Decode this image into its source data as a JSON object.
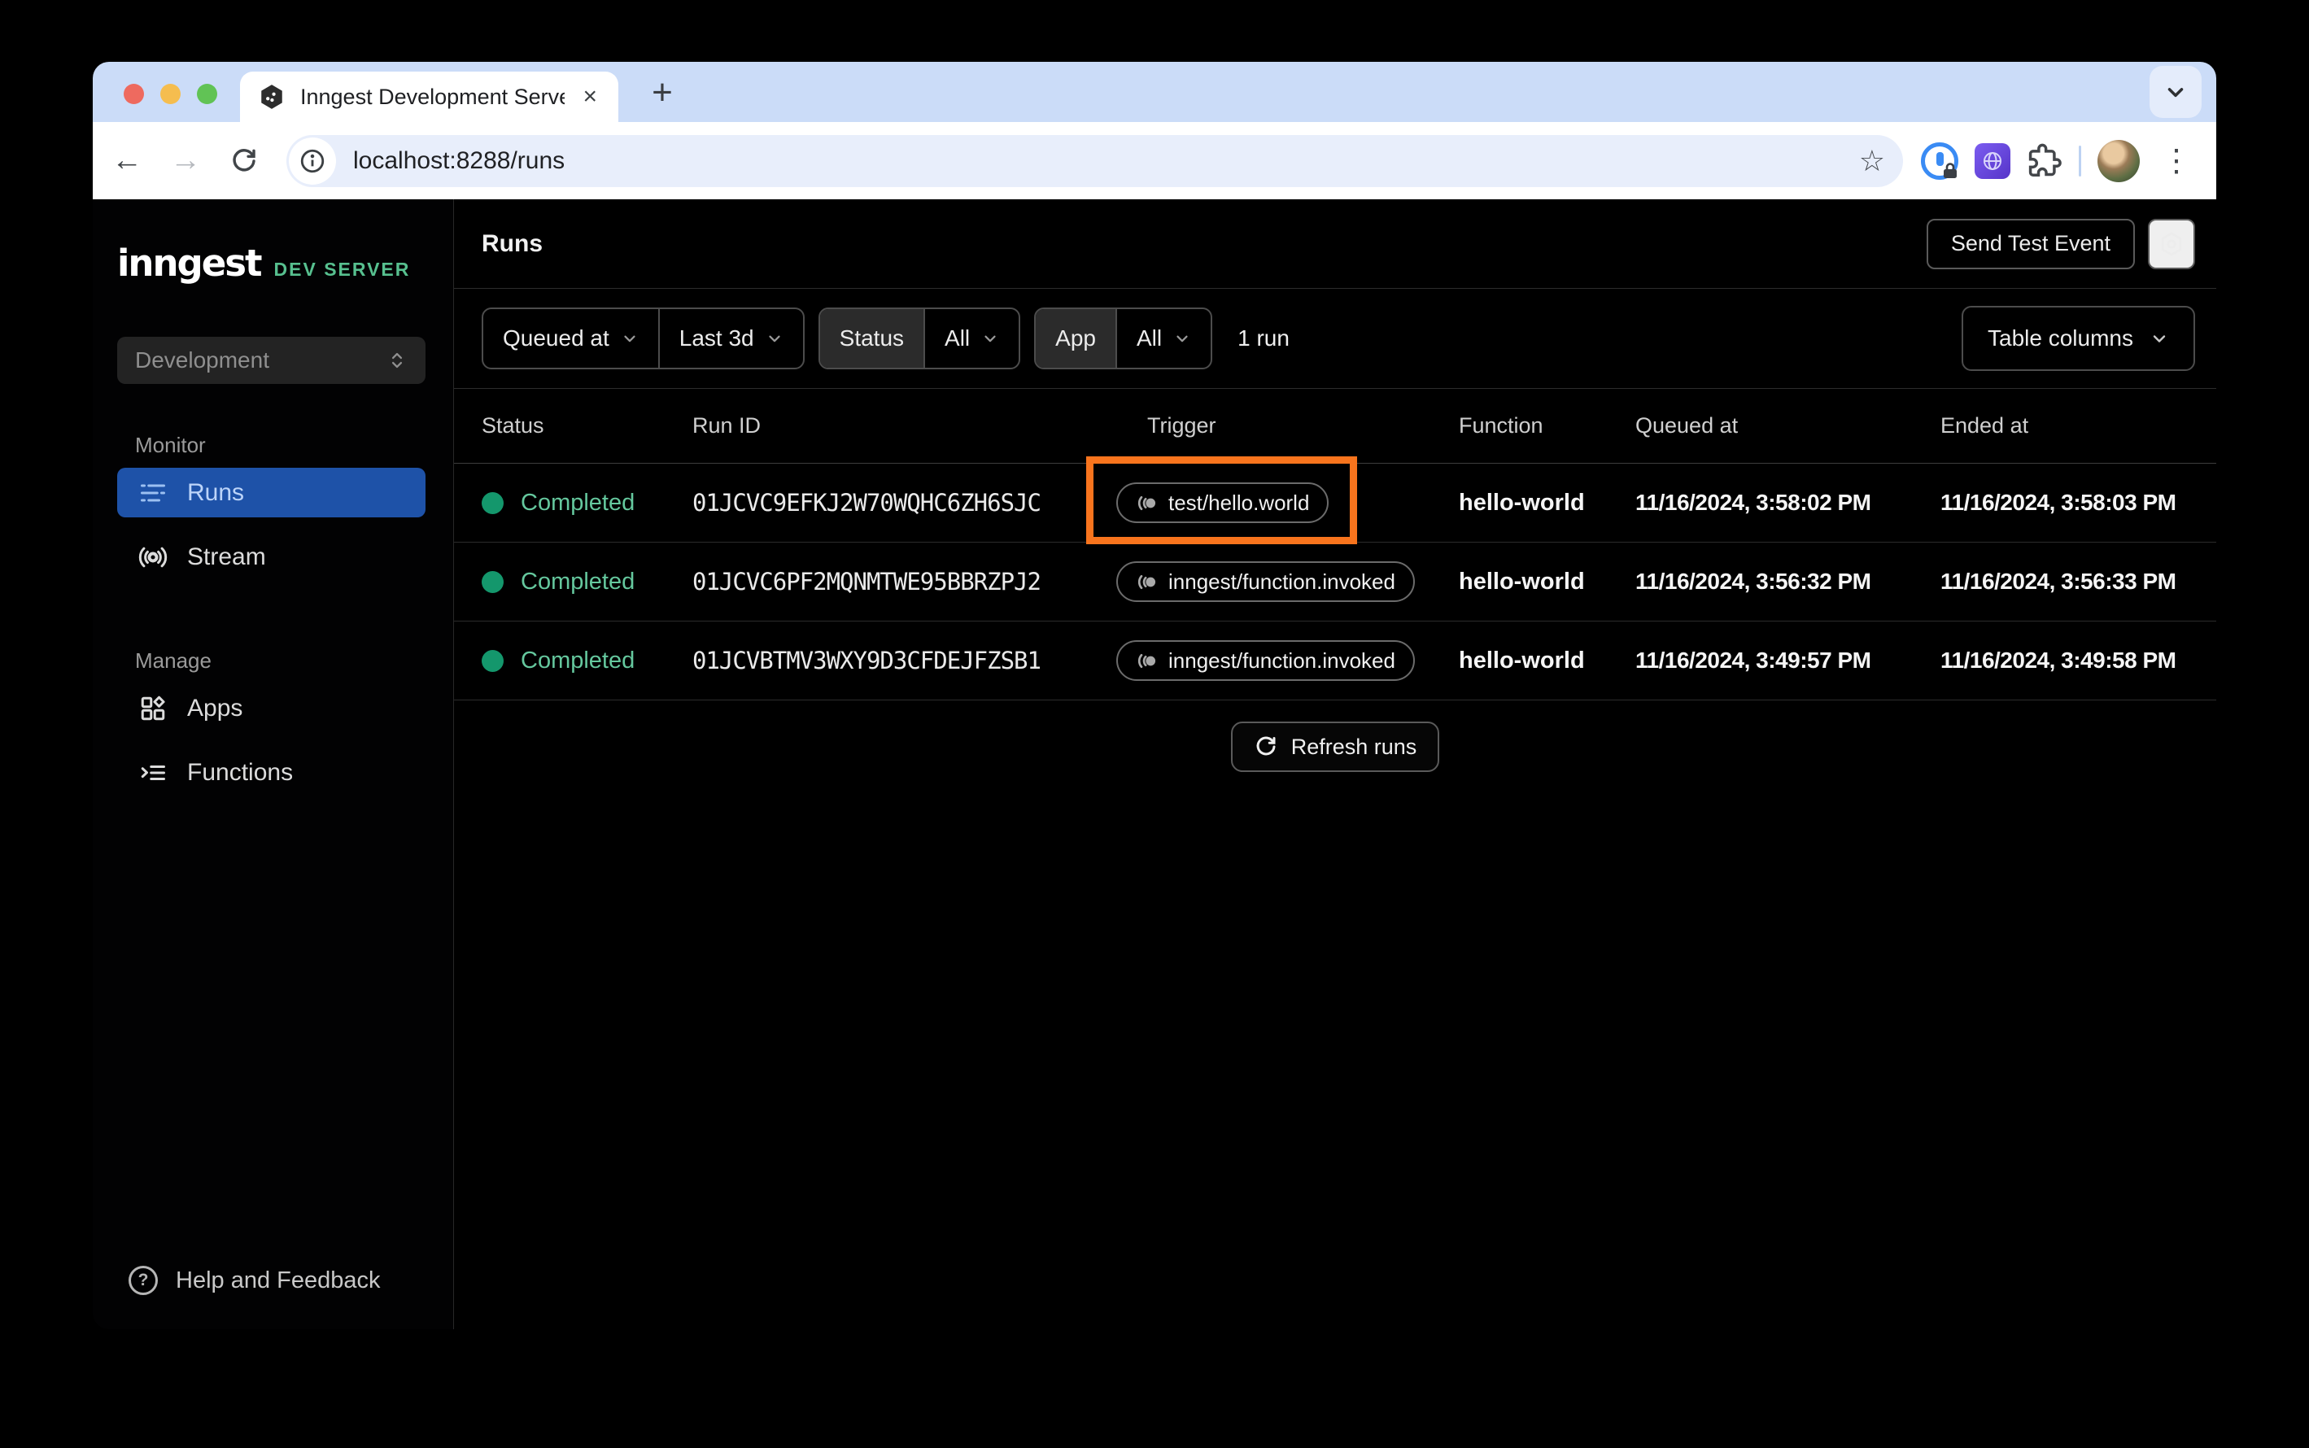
{
  "browser": {
    "tab_title": "Inngest Development Server",
    "url": "localhost:8288/runs",
    "icons": {
      "back": "←",
      "forward": "→",
      "close_tab": "×",
      "new_tab": "+",
      "star": "☆",
      "more": "⋮",
      "help": "?"
    }
  },
  "colors": {
    "accent_green": "#57c08f",
    "active_item_blue": "#1e52a8",
    "status_dot_green": "#14976c",
    "status_text_green": "#65c89e",
    "highlight_orange": "#f8741d",
    "tabstrip_blue": "#cbdcf8"
  },
  "sidebar": {
    "logo": "inngest",
    "logo_badge": "DEV SERVER",
    "env_selector": "Development",
    "monitor_label": "Monitor",
    "manage_label": "Manage",
    "items": [
      {
        "label": "Runs"
      },
      {
        "label": "Stream"
      },
      {
        "label": "Apps"
      },
      {
        "label": "Functions"
      }
    ],
    "help_label": "Help and Feedback"
  },
  "header": {
    "title": "Runs",
    "send_test_event_label": "Send Test Event"
  },
  "filters": {
    "queued_at_label": "Queued at",
    "time_range_value": "Last 3d",
    "status_label": "Status",
    "status_value": "All",
    "app_label": "App",
    "app_value": "All",
    "result_count": "1 run",
    "table_columns_label": "Table columns"
  },
  "table": {
    "columns": [
      "Status",
      "Run ID",
      "Trigger",
      "Function",
      "Queued at",
      "Ended at"
    ],
    "rows": [
      {
        "status": "Completed",
        "run_id": "01JCVC9EFKJ2W70WQHC6ZH6SJC",
        "trigger": "test/hello.world",
        "function": "hello-world",
        "queued_at": "11/16/2024, 3:58:02 PM",
        "ended_at": "11/16/2024, 3:58:03 PM"
      },
      {
        "status": "Completed",
        "run_id": "01JCVC6PF2MQNMTWE95BBRZPJ2",
        "trigger": "inngest/function.invoked",
        "function": "hello-world",
        "queued_at": "11/16/2024, 3:56:32 PM",
        "ended_at": "11/16/2024, 3:56:33 PM"
      },
      {
        "status": "Completed",
        "run_id": "01JCVBTMV3WXY9D3CFDEJFZSB1",
        "trigger": "inngest/function.invoked",
        "function": "hello-world",
        "queued_at": "11/16/2024, 3:49:57 PM",
        "ended_at": "11/16/2024, 3:49:58 PM"
      }
    ],
    "refresh_label": "Refresh runs"
  }
}
